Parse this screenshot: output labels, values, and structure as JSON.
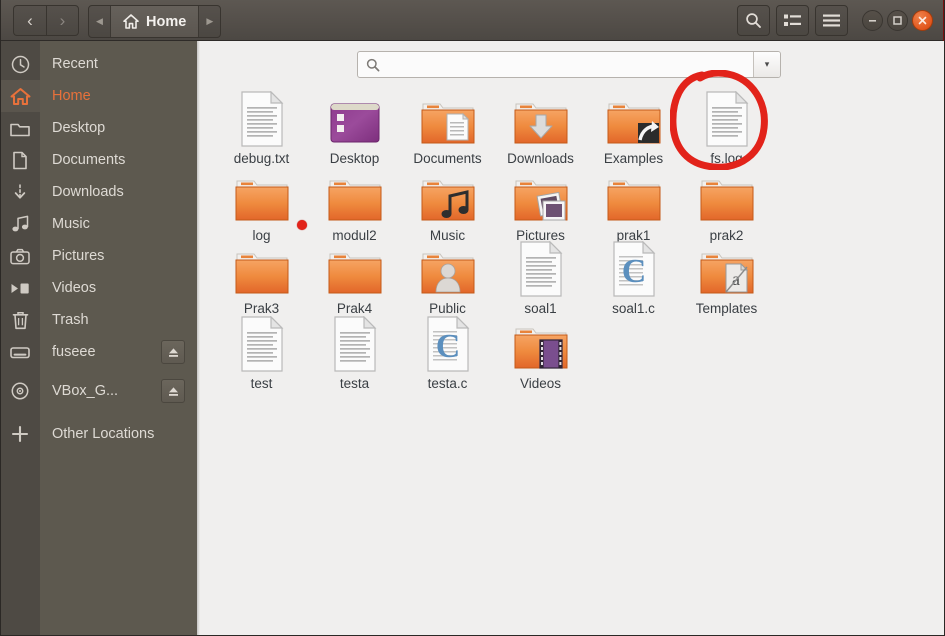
{
  "window": {
    "title": "Home",
    "controls": {
      "minimize": "minimize-button",
      "maximize": "maximize-button",
      "close": "close-button"
    }
  },
  "header": {
    "back_label": "‹",
    "forward_label": "›",
    "breadcrumb_prev": "◀",
    "breadcrumb_next": "▶",
    "breadcrumb_label": "Home",
    "search_button": "search-icon",
    "view_button": "list-view-icon",
    "menu_button": "hamburger-menu-icon"
  },
  "pathbar": {
    "value": "",
    "placeholder": "",
    "icon": "search-icon",
    "dropdown": "▾"
  },
  "sidebar": {
    "items": [
      {
        "label": "Recent",
        "icon": "clock-icon",
        "selected": false,
        "eject": false
      },
      {
        "label": "Home",
        "icon": "home-icon",
        "selected": true,
        "eject": false
      },
      {
        "label": "Desktop",
        "icon": "folder-icon",
        "selected": false,
        "eject": false
      },
      {
        "label": "Documents",
        "icon": "document-icon",
        "selected": false,
        "eject": false
      },
      {
        "label": "Downloads",
        "icon": "download-icon",
        "selected": false,
        "eject": false
      },
      {
        "label": "Music",
        "icon": "music-icon",
        "selected": false,
        "eject": false
      },
      {
        "label": "Pictures",
        "icon": "camera-icon",
        "selected": false,
        "eject": false
      },
      {
        "label": "Videos",
        "icon": "video-icon",
        "selected": false,
        "eject": false
      },
      {
        "label": "Trash",
        "icon": "trash-icon",
        "selected": false,
        "eject": false
      },
      {
        "label": "fuseee",
        "icon": "drive-icon",
        "selected": false,
        "eject": true
      },
      {
        "label": "VBox_G...",
        "icon": "disc-icon",
        "selected": false,
        "eject": true
      },
      {
        "label": "Other Locations",
        "icon": "plus-icon",
        "selected": false,
        "eject": false
      }
    ]
  },
  "files": [
    {
      "name": "debug.txt",
      "type": "text-file"
    },
    {
      "name": "Desktop",
      "type": "folder-desktop"
    },
    {
      "name": "Documents",
      "type": "folder-documents"
    },
    {
      "name": "Downloads",
      "type": "folder-downloads"
    },
    {
      "name": "Examples",
      "type": "folder-link"
    },
    {
      "name": "fs.log",
      "type": "text-file"
    },
    {
      "name": "log",
      "type": "folder"
    },
    {
      "name": "modul2",
      "type": "folder"
    },
    {
      "name": "Music",
      "type": "folder-music"
    },
    {
      "name": "Pictures",
      "type": "folder-pictures"
    },
    {
      "name": "prak1",
      "type": "folder"
    },
    {
      "name": "prak2",
      "type": "folder"
    },
    {
      "name": "Prak3",
      "type": "folder"
    },
    {
      "name": "Prak4",
      "type": "folder"
    },
    {
      "name": "Public",
      "type": "folder-public"
    },
    {
      "name": "soal1",
      "type": "text-file"
    },
    {
      "name": "soal1.c",
      "type": "c-file"
    },
    {
      "name": "Templates",
      "type": "folder-templates"
    },
    {
      "name": "test",
      "type": "text-file"
    },
    {
      "name": "testa",
      "type": "text-file"
    },
    {
      "name": "testa.c",
      "type": "c-file"
    },
    {
      "name": "Videos",
      "type": "folder-videos"
    }
  ],
  "annotations": {
    "circle": {
      "target": "fs.log",
      "color": "#e2231a"
    },
    "dot": {
      "color": "#e2231a"
    }
  },
  "colors": {
    "header_bg": "#544f4a",
    "sidebar_bg": "#5d594f",
    "iconstrip_bg": "#4e4a44",
    "content_bg": "#f0efee",
    "accent": "#e8713b",
    "annotation": "#e2231a",
    "folder": "#e8833a",
    "label_text": "#3a3f44"
  }
}
